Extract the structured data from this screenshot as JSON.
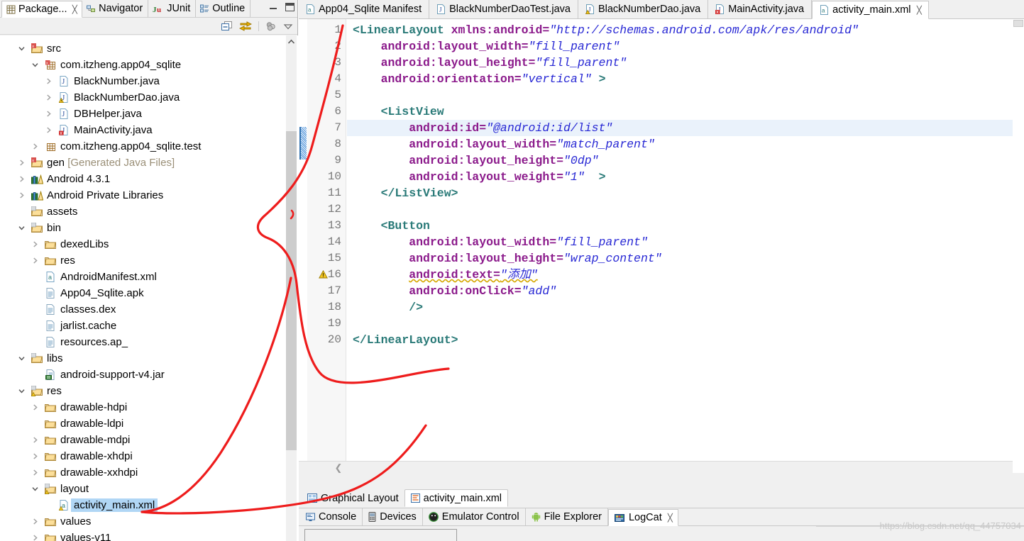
{
  "left_panel": {
    "tabs": [
      {
        "label": "Package...",
        "icon": "package-explorer-icon",
        "active": true,
        "closable": true
      },
      {
        "label": "Navigator",
        "icon": "navigator-icon",
        "active": false,
        "closable": false
      },
      {
        "label": "JUnit",
        "icon": "junit-icon",
        "active": false,
        "closable": false
      },
      {
        "label": "Outline",
        "icon": "outline-icon",
        "active": false,
        "closable": false
      }
    ],
    "window_buttons": [
      "minimize",
      "maximize"
    ],
    "toolbar_icons": [
      "collapse-all-icon",
      "link-with-editor-icon",
      "focus-on-active-task-icon",
      "view-menu-icon"
    ],
    "tree": [
      {
        "label": "src",
        "indent": 1,
        "twisty": "open",
        "icon": "source-folder-icon"
      },
      {
        "label": "com.itzheng.app04_sqlite",
        "indent": 2,
        "twisty": "open",
        "icon": "package-icon"
      },
      {
        "label": "BlackNumber.java",
        "indent": 3,
        "twisty": "closed",
        "icon": "java-file-icon"
      },
      {
        "label": "BlackNumberDao.java",
        "indent": 3,
        "twisty": "closed",
        "icon": "java-file-warning-icon"
      },
      {
        "label": "DBHelper.java",
        "indent": 3,
        "twisty": "closed",
        "icon": "java-file-icon"
      },
      {
        "label": "MainActivity.java",
        "indent": 3,
        "twisty": "closed",
        "icon": "java-file-error-icon"
      },
      {
        "label": "com.itzheng.app04_sqlite.test",
        "indent": 2,
        "twisty": "closed",
        "icon": "package-icon"
      },
      {
        "label": "gen",
        "suffix": " [Generated Java Files]",
        "indent": 1,
        "twisty": "closed",
        "icon": "source-folder-icon"
      },
      {
        "label": "Android 4.3.1",
        "indent": 1,
        "twisty": "closed",
        "icon": "library-icon"
      },
      {
        "label": "Android Private Libraries",
        "indent": 1,
        "twisty": "closed",
        "icon": "library-icon"
      },
      {
        "label": "assets",
        "indent": 1,
        "twisty": "none",
        "icon": "folder-res-icon"
      },
      {
        "label": "bin",
        "indent": 1,
        "twisty": "open",
        "icon": "folder-res-icon"
      },
      {
        "label": "dexedLibs",
        "indent": 2,
        "twisty": "closed",
        "icon": "folder-icon"
      },
      {
        "label": "res",
        "indent": 2,
        "twisty": "closed",
        "icon": "folder-icon"
      },
      {
        "label": "AndroidManifest.xml",
        "indent": 2,
        "twisty": "none",
        "icon": "xml-file-icon"
      },
      {
        "label": "App04_Sqlite.apk",
        "indent": 2,
        "twisty": "none",
        "icon": "file-icon"
      },
      {
        "label": "classes.dex",
        "indent": 2,
        "twisty": "none",
        "icon": "file-icon"
      },
      {
        "label": "jarlist.cache",
        "indent": 2,
        "twisty": "none",
        "icon": "file-icon"
      },
      {
        "label": "resources.ap_",
        "indent": 2,
        "twisty": "none",
        "icon": "file-icon"
      },
      {
        "label": "libs",
        "indent": 1,
        "twisty": "open",
        "icon": "folder-res-icon"
      },
      {
        "label": "android-support-v4.jar",
        "indent": 2,
        "twisty": "none",
        "icon": "jar-icon"
      },
      {
        "label": "res",
        "indent": 1,
        "twisty": "open",
        "icon": "folder-res-warning-icon"
      },
      {
        "label": "drawable-hdpi",
        "indent": 2,
        "twisty": "closed",
        "icon": "folder-icon"
      },
      {
        "label": "drawable-ldpi",
        "indent": 2,
        "twisty": "none",
        "icon": "folder-icon"
      },
      {
        "label": "drawable-mdpi",
        "indent": 2,
        "twisty": "closed",
        "icon": "folder-icon"
      },
      {
        "label": "drawable-xhdpi",
        "indent": 2,
        "twisty": "closed",
        "icon": "folder-icon"
      },
      {
        "label": "drawable-xxhdpi",
        "indent": 2,
        "twisty": "closed",
        "icon": "folder-icon"
      },
      {
        "label": "layout",
        "indent": 2,
        "twisty": "open",
        "icon": "folder-res-warning-icon"
      },
      {
        "label": "activity_main.xml",
        "indent": 3,
        "twisty": "none",
        "icon": "xml-file-warning-icon",
        "selected": true
      },
      {
        "label": "values",
        "indent": 2,
        "twisty": "closed",
        "icon": "folder-icon"
      },
      {
        "label": "values-v11",
        "indent": 2,
        "twisty": "closed",
        "icon": "folder-icon"
      }
    ]
  },
  "editor": {
    "tabs": [
      {
        "label": "App04_Sqlite Manifest",
        "icon": "manifest-icon",
        "active": false,
        "closable": false
      },
      {
        "label": "BlackNumberDaoTest.java",
        "icon": "java-file-icon",
        "active": false,
        "closable": false
      },
      {
        "label": "BlackNumberDao.java",
        "icon": "java-file-warning-icon",
        "active": false,
        "closable": false
      },
      {
        "label": "MainActivity.java",
        "icon": "java-file-error-icon",
        "active": false,
        "closable": false
      },
      {
        "label": "activity_main.xml",
        "icon": "xml-file-icon",
        "active": true,
        "closable": true
      }
    ],
    "highlighted_line": 7,
    "warning_lines": [
      16
    ],
    "changed_lines": [
      7,
      8
    ],
    "code": [
      {
        "n": 1,
        "indent": 0,
        "parts": [
          {
            "t": "<LinearLayout",
            "c": "tag"
          },
          {
            "t": " ",
            "c": "plain"
          },
          {
            "t": "xmlns:android=",
            "c": "attr"
          },
          {
            "t": "\"http://schemas.android.com/apk/res/android\"",
            "c": "val"
          }
        ]
      },
      {
        "n": 2,
        "indent": 4,
        "parts": [
          {
            "t": "android:layout_width=",
            "c": "attr"
          },
          {
            "t": "\"fill_parent\"",
            "c": "val"
          }
        ]
      },
      {
        "n": 3,
        "indent": 4,
        "parts": [
          {
            "t": "android:layout_height=",
            "c": "attr"
          },
          {
            "t": "\"fill_parent\"",
            "c": "val"
          }
        ]
      },
      {
        "n": 4,
        "indent": 4,
        "parts": [
          {
            "t": "android:orientation=",
            "c": "attr"
          },
          {
            "t": "\"vertical\"",
            "c": "val"
          },
          {
            "t": " ",
            "c": "plain"
          },
          {
            "t": ">",
            "c": "tag"
          }
        ]
      },
      {
        "n": 5,
        "indent": 0,
        "parts": []
      },
      {
        "n": 6,
        "indent": 4,
        "parts": [
          {
            "t": "<ListView",
            "c": "tag"
          }
        ]
      },
      {
        "n": 7,
        "indent": 8,
        "parts": [
          {
            "t": "android:id=",
            "c": "attr"
          },
          {
            "t": "\"@android:id/list\"",
            "c": "val"
          }
        ]
      },
      {
        "n": 8,
        "indent": 8,
        "parts": [
          {
            "t": "android:layout_width=",
            "c": "attr"
          },
          {
            "t": "\"match_parent\"",
            "c": "val"
          }
        ]
      },
      {
        "n": 9,
        "indent": 8,
        "parts": [
          {
            "t": "android:layout_height=",
            "c": "attr"
          },
          {
            "t": "\"0dp\"",
            "c": "val"
          }
        ]
      },
      {
        "n": 10,
        "indent": 8,
        "parts": [
          {
            "t": "android:layout_weight=",
            "c": "attr"
          },
          {
            "t": "\"1\"",
            "c": "val"
          },
          {
            "t": "  ",
            "c": "plain"
          },
          {
            "t": ">",
            "c": "tag"
          }
        ]
      },
      {
        "n": 11,
        "indent": 4,
        "parts": [
          {
            "t": "</ListView>",
            "c": "tag"
          }
        ]
      },
      {
        "n": 12,
        "indent": 0,
        "parts": []
      },
      {
        "n": 13,
        "indent": 4,
        "parts": [
          {
            "t": "<Button",
            "c": "tag"
          }
        ]
      },
      {
        "n": 14,
        "indent": 8,
        "parts": [
          {
            "t": "android:layout_width=",
            "c": "attr"
          },
          {
            "t": "\"fill_parent\"",
            "c": "val"
          }
        ]
      },
      {
        "n": 15,
        "indent": 8,
        "parts": [
          {
            "t": "android:layout_height=",
            "c": "attr"
          },
          {
            "t": "\"wrap_content\"",
            "c": "val"
          }
        ]
      },
      {
        "n": 16,
        "indent": 8,
        "parts": [
          {
            "t": "android:text=",
            "c": "attr squiggle"
          },
          {
            "t": "\"添加\"",
            "c": "val squiggle"
          }
        ]
      },
      {
        "n": 17,
        "indent": 8,
        "parts": [
          {
            "t": "android:onClick=",
            "c": "attr"
          },
          {
            "t": "\"add\"",
            "c": "val"
          }
        ]
      },
      {
        "n": 18,
        "indent": 8,
        "parts": [
          {
            "t": "/>",
            "c": "tag"
          }
        ]
      },
      {
        "n": 19,
        "indent": 0,
        "parts": []
      },
      {
        "n": 20,
        "indent": 0,
        "parts": [
          {
            "t": "</LinearLayout>",
            "c": "tag"
          }
        ]
      }
    ],
    "form_tabs": [
      {
        "label": "Graphical Layout",
        "icon": "graphical-layout-icon",
        "active": false
      },
      {
        "label": "activity_main.xml",
        "icon": "xml-source-icon",
        "active": true
      }
    ]
  },
  "bottom_panel": {
    "tabs": [
      {
        "label": "Console",
        "icon": "console-icon",
        "active": false,
        "closable": false
      },
      {
        "label": "Devices",
        "icon": "devices-icon",
        "active": false,
        "closable": false
      },
      {
        "label": "Emulator Control",
        "icon": "emulator-control-icon",
        "active": false,
        "closable": false
      },
      {
        "label": "File Explorer",
        "icon": "file-explorer-icon",
        "active": false,
        "closable": false
      },
      {
        "label": "LogCat",
        "icon": "logcat-icon",
        "active": true,
        "closable": true
      }
    ],
    "search_value": "",
    "search_placeholder": ""
  },
  "watermark": "https://blog.csdn.net/qq_44757034",
  "colors": {
    "tag": "#2a7a78",
    "attribute": "#8b1a8b",
    "value": "#2727d4",
    "selection": "#b0d6f5",
    "highlight_line": "#eaf2fb",
    "annotation": "#ee1c1c",
    "panel_bg": "#f0f0f0"
  }
}
